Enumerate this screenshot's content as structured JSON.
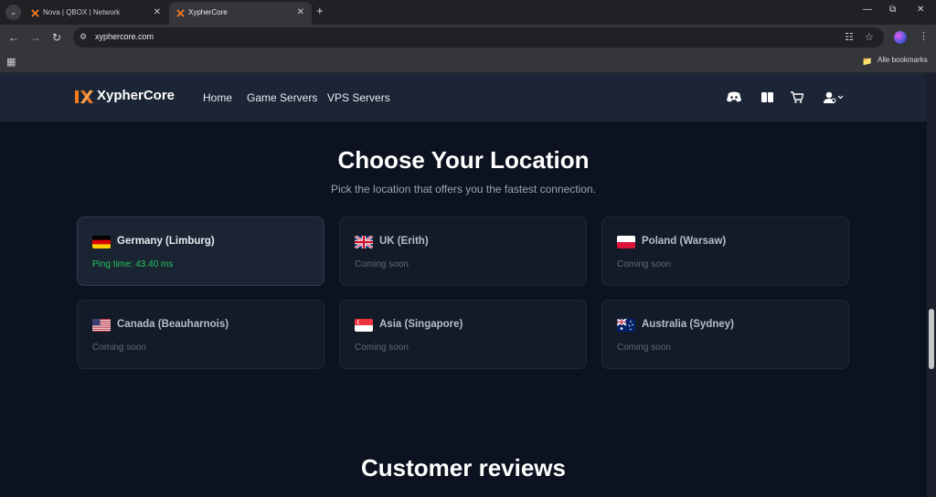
{
  "browser": {
    "tabs": [
      {
        "title": "Nova | QBOX | Network"
      },
      {
        "title": "XypherCore"
      }
    ],
    "url": "xyphercore.com",
    "bookmarks_label": "Alle bookmarks"
  },
  "site": {
    "brand": "XypherCore",
    "nav": [
      "Home",
      "Game Servers",
      "VPS Servers"
    ],
    "header_icons": [
      "discord-icon",
      "book-icon",
      "cart-icon",
      "user-icon"
    ]
  },
  "location_section": {
    "title": "Choose Your Location",
    "subtitle": "Pick the location that offers you the fastest connection.",
    "locations": [
      {
        "name": "Germany (Limburg)",
        "status": "Ping time: 43.40 ms",
        "flag": "de",
        "available": true
      },
      {
        "name": "UK (Erith)",
        "status": "Coming soon",
        "flag": "uk",
        "available": false
      },
      {
        "name": "Poland (Warsaw)",
        "status": "Coming soon",
        "flag": "pl",
        "available": false
      },
      {
        "name": "Canada (Beauharnois)",
        "status": "Coming soon",
        "flag": "us",
        "available": false
      },
      {
        "name": "Asia (Singapore)",
        "status": "Coming soon",
        "flag": "sg",
        "available": false
      },
      {
        "name": "Australia (Sydney)",
        "status": "Coming soon",
        "flag": "au",
        "available": false
      }
    ]
  },
  "reviews_section": {
    "title": "Customer reviews"
  },
  "colors": {
    "background": "#0d1220",
    "header": "#1c2535",
    "ping_green": "#22c55e",
    "brand_orange": "#f27a21"
  }
}
